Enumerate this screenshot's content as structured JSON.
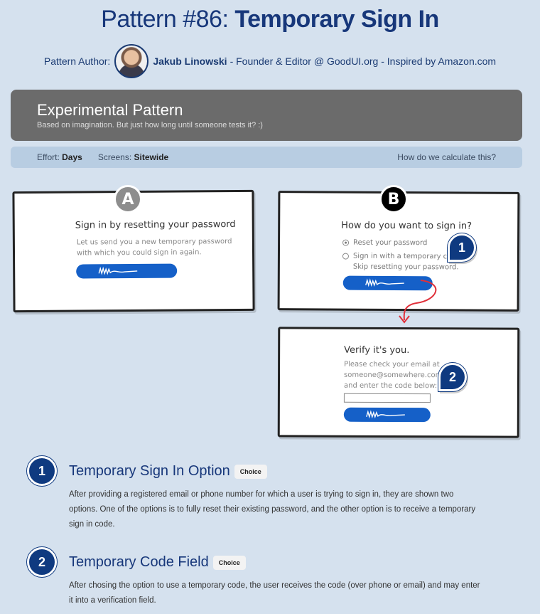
{
  "header": {
    "title_prefix": "Pattern #86: ",
    "title_bold": "Temporary Sign In",
    "author_label": "Pattern Author:",
    "author_name": "Jakub Linowski",
    "author_rest": " - Founder & Editor @ GoodUI.org - Inspired by Amazon.com"
  },
  "banner": {
    "heading": "Experimental Pattern",
    "subtext": "Based on imagination. But just how long until someone tests it? :)"
  },
  "effort_bar": {
    "effort_label": "Effort:",
    "effort_value": "Days",
    "screens_label": "Screens:",
    "screens_value": "Sitewide",
    "calc_link": "How do we calculate this?"
  },
  "variant_a": {
    "badge": "A",
    "heading": "Sign in by resetting your password",
    "body_line1": "Let us send you a new temporary password",
    "body_line2": "with which you could sign in again."
  },
  "variant_b": {
    "badge": "B",
    "heading": "How do you want to sign in?",
    "option1": "Reset your password",
    "option2_line1": "Sign in with a temporary code.",
    "option2_line2": "Skip resetting your password.",
    "marker": "1"
  },
  "verify": {
    "heading": "Verify it's you.",
    "line1": "Please check your email at",
    "line2": "someone@somewhere.com",
    "line3": "and enter the code below:",
    "marker": "2"
  },
  "items": [
    {
      "number": "1",
      "title": "Temporary Sign In Option",
      "chip": "Choice",
      "description": "After providing a registered email or phone number for which a user is trying to sign in, they are shown two options. One of the options is to fully reset their existing password, and the other option is to receive a temporary sign in code."
    },
    {
      "number": "2",
      "title": "Temporary Code Field",
      "chip": "Choice",
      "description": "After chosing the option to use a temporary code, the user receives the code (over phone or email) and may enter it into a verification field."
    }
  ],
  "colors": {
    "background": "#d5e1ee",
    "accent": "#0f3a80",
    "button": "#1560c8",
    "arrow": "#e0303a"
  }
}
